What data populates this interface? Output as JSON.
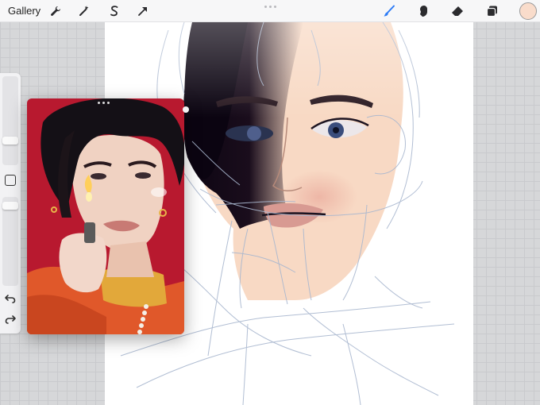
{
  "toolbar": {
    "gallery_label": "Gallery",
    "left_tools": [
      "wrench-icon",
      "magic-wand-icon",
      "selection-s-icon",
      "transform-arrow-icon"
    ],
    "right_tools": [
      "brush-icon",
      "smudge-icon",
      "eraser-icon",
      "layers-icon"
    ],
    "active_tool": "brush-icon",
    "current_color": "#f9dccb",
    "accent_color": "#2e7cf6"
  },
  "sidebar": {
    "brush_size_level": 0.75,
    "opacity_level": 0.55
  },
  "canvas": {
    "background": "#ffffff",
    "skin_color": "#f8d9c4",
    "shadow_color": "#140a16",
    "sketch_color": "#a9b7cf"
  },
  "reference": {
    "background": "#b8192f",
    "sweater_color": "#e0582a",
    "collar_color": "#e2a83a"
  }
}
